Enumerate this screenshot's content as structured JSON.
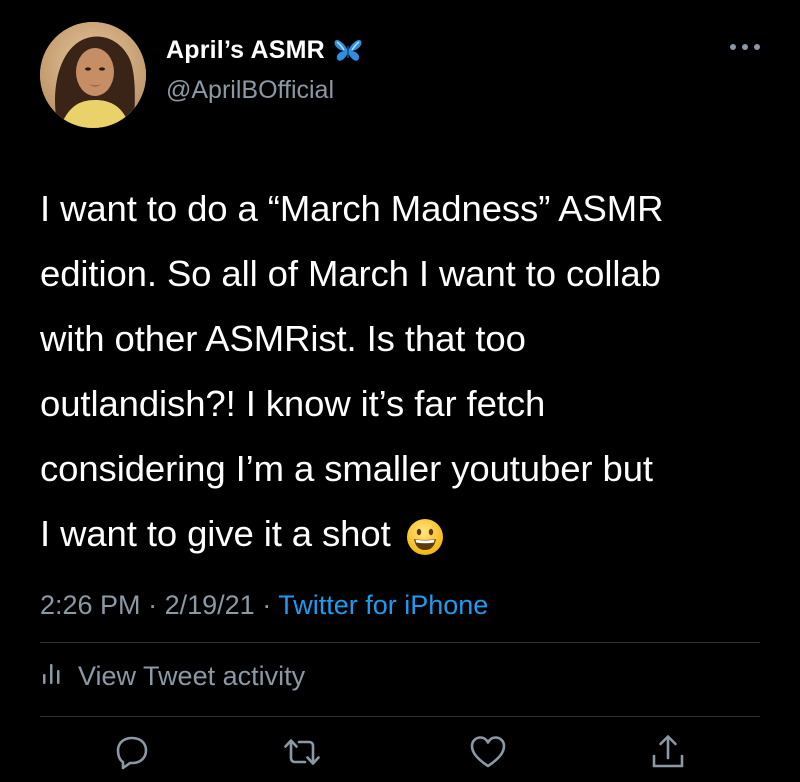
{
  "author": {
    "display_name": "April’s ASMR",
    "handle": "@AprilBOfficial",
    "badge_icon": "butterfly-emoji-icon"
  },
  "tweet": {
    "lines": [
      "I want to do a “March Madness” ASMR",
      "edition. So all of March I want to collab",
      "with other ASMRist. Is that too",
      "outlandish?! I know it’s far fetch",
      "considering I’m a smaller youtuber but",
      "I want to give it a shot"
    ],
    "trailing_emoji": "grinning-face-emoji"
  },
  "meta": {
    "time": "2:26 PM",
    "separator": "·",
    "date": "2/19/21",
    "source": "Twitter for iPhone"
  },
  "activity": {
    "label": "View Tweet activity"
  },
  "actions": [
    "reply-icon",
    "retweet-icon",
    "like-icon",
    "share-icon"
  ],
  "colors": {
    "background": "#000000",
    "text": "#ffffff",
    "secondary": "#8b98a5",
    "link": "#1d9bf0",
    "divider": "#2f3336"
  }
}
